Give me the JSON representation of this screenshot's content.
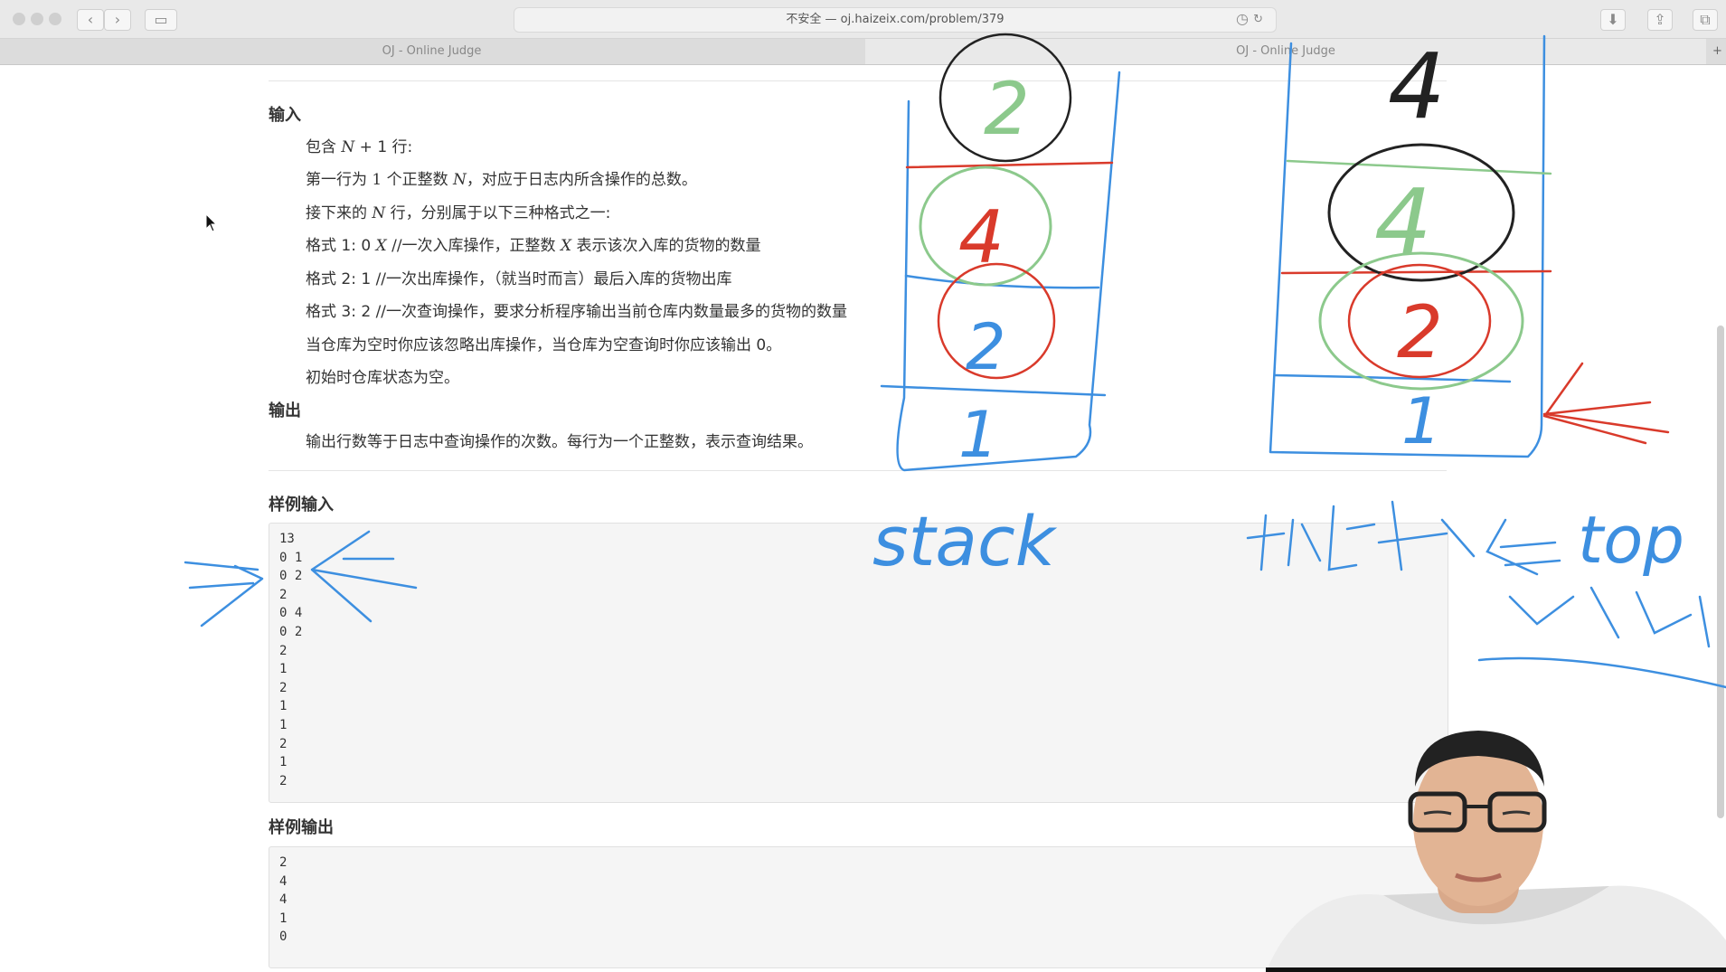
{
  "browser": {
    "url": "不安全 — oj.haizeix.com/problem/379",
    "tabs": [
      {
        "label": "OJ - Online Judge",
        "active": false
      },
      {
        "label": "OJ - Online Judge",
        "active": true
      }
    ],
    "colors": {
      "accent": "#7ab648",
      "chrome": "#e9e9e9"
    }
  },
  "problem": {
    "input_title": "输入",
    "input_lines": {
      "l1_a": "包含 ",
      "l1_math": "N",
      "l1_b": " + 1 行:",
      "l2_a": "第一行为 ",
      "l2_num": "1",
      "l2_b": " 个正整数 ",
      "l2_math": "N",
      "l2_c": "，对应于日志内所含操作的总数。",
      "l3_a": "接下来的 ",
      "l3_math": "N",
      "l3_b": " 行，分别属于以下三种格式之一:",
      "l4_a": "格式 1: 0 ",
      "l4_math": "X",
      "l4_b": " //一次入库操作，正整数 ",
      "l4_math2": "X",
      "l4_c": " 表示该次入库的货物的数量",
      "l5": "格式 2: 1 //一次出库操作，（就当时而言）最后入库的货物出库",
      "l6": "格式 3: 2 //一次查询操作，要求分析程序输出当前仓库内数量最多的货物的数量",
      "l7": "当仓库为空时你应该忽略出库操作，当仓库为空查询时你应该输出 0。",
      "l8": "初始时仓库状态为空。"
    },
    "output_title": "输出",
    "output_line": "输出行数等于日志中查询操作的次数。每行为一个正整数，表示查询结果。",
    "sample_input_title": "样例输入",
    "sample_input": [
      "13",
      "0 1",
      "0 2",
      "2",
      "0 4",
      "0 2",
      "2",
      "1",
      "2",
      "1",
      "1",
      "2",
      "1",
      "2"
    ],
    "sample_output_title": "样例输出",
    "sample_output": [
      "2",
      "4",
      "4",
      "1",
      "0"
    ]
  },
  "annotations": {
    "stack_word": "stack",
    "stack_digits": [
      "2",
      "4",
      "2",
      "1"
    ],
    "right_stack_digits": [
      "4",
      "4",
      "2",
      "1"
    ],
    "note_word": "top",
    "colors": {
      "blue": "#3d8fe0",
      "red": "#d93a2b",
      "green": "#8cc98c",
      "black": "#222222"
    }
  }
}
